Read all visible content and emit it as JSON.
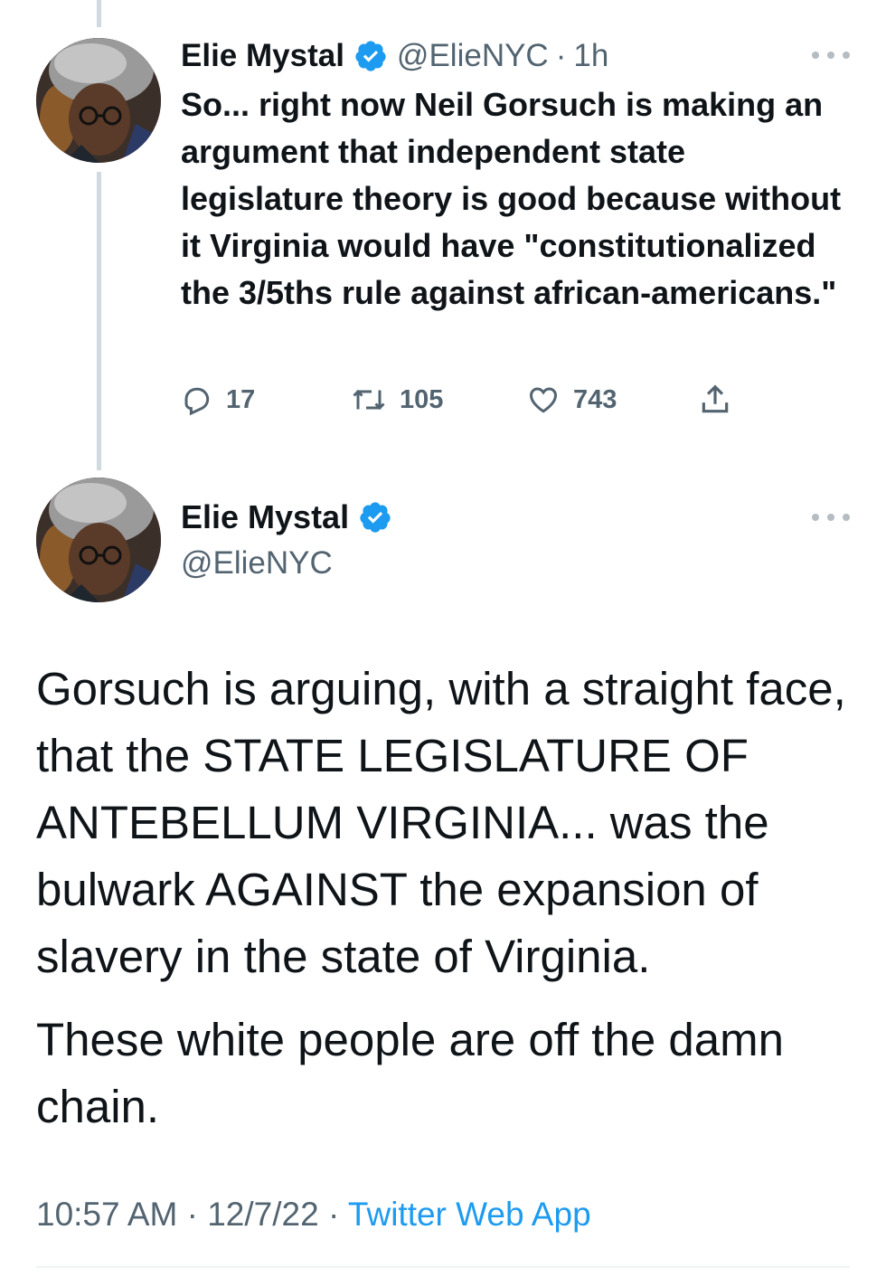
{
  "colors": {
    "accent": "#1d9bf0",
    "text": "#0f1419",
    "secondary": "#536471",
    "thread_line": "#cfd9de"
  },
  "reply_tweet": {
    "author_name": "Elie Mystal",
    "verified_icon": "verified-badge-icon",
    "handle": "@ElieNYC",
    "separator": "·",
    "time": "1h",
    "text": "So... right now Neil Gorsuch is making an argument that independent state legislature theory is good because without it Virginia would have \"constitutionalized the 3/5ths rule against african-americans.\"",
    "actions": {
      "reply_icon": "reply-icon",
      "reply_count": "17",
      "retweet_icon": "retweet-icon",
      "retweet_count": "105",
      "like_icon": "heart-icon",
      "like_count": "743",
      "share_icon": "share-icon"
    }
  },
  "main_tweet": {
    "author_name": "Elie Mystal",
    "verified_icon": "verified-badge-icon",
    "handle": "@ElieNYC",
    "paragraphs": [
      "Gorsuch is arguing, with a straight face, that the STATE LEGISLATURE OF ANTEBELLUM VIRGINIA... was the bulwark AGAINST the expansion of slavery in the state of Virginia.",
      "These white people are off the damn chain."
    ],
    "timestamp": "10:57 AM",
    "separator": "·",
    "date": "12/7/22",
    "source": "Twitter Web App"
  }
}
